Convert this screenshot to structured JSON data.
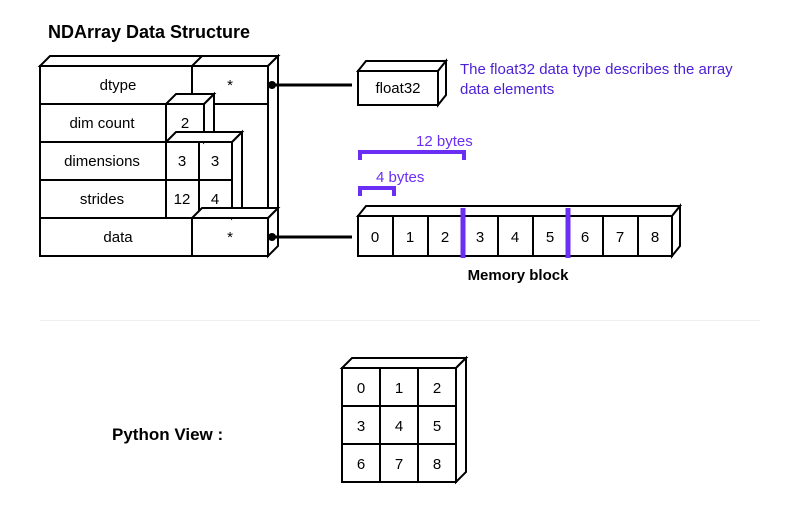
{
  "title": "NDArray Data Structure",
  "rows": {
    "dtype": {
      "label": "dtype",
      "val": "*"
    },
    "dimcount": {
      "label": "dim count",
      "val": "2"
    },
    "dimensions": {
      "label": "dimensions",
      "val0": "3",
      "val1": "3"
    },
    "strides": {
      "label": "strides",
      "val0": "12",
      "val1": "4"
    },
    "data": {
      "label": "data",
      "val": "*"
    }
  },
  "dtype_box": "float32",
  "dtype_desc": "The float32 data type describes the array data elements",
  "bracket12": "12 bytes",
  "bracket4": "4 bytes",
  "memory": [
    "0",
    "1",
    "2",
    "3",
    "4",
    "5",
    "6",
    "7",
    "8"
  ],
  "memory_label": "Memory block",
  "python_view_label": "Python View :",
  "python_view": [
    [
      "0",
      "1",
      "2"
    ],
    [
      "3",
      "4",
      "5"
    ],
    [
      "6",
      "7",
      "8"
    ]
  ]
}
